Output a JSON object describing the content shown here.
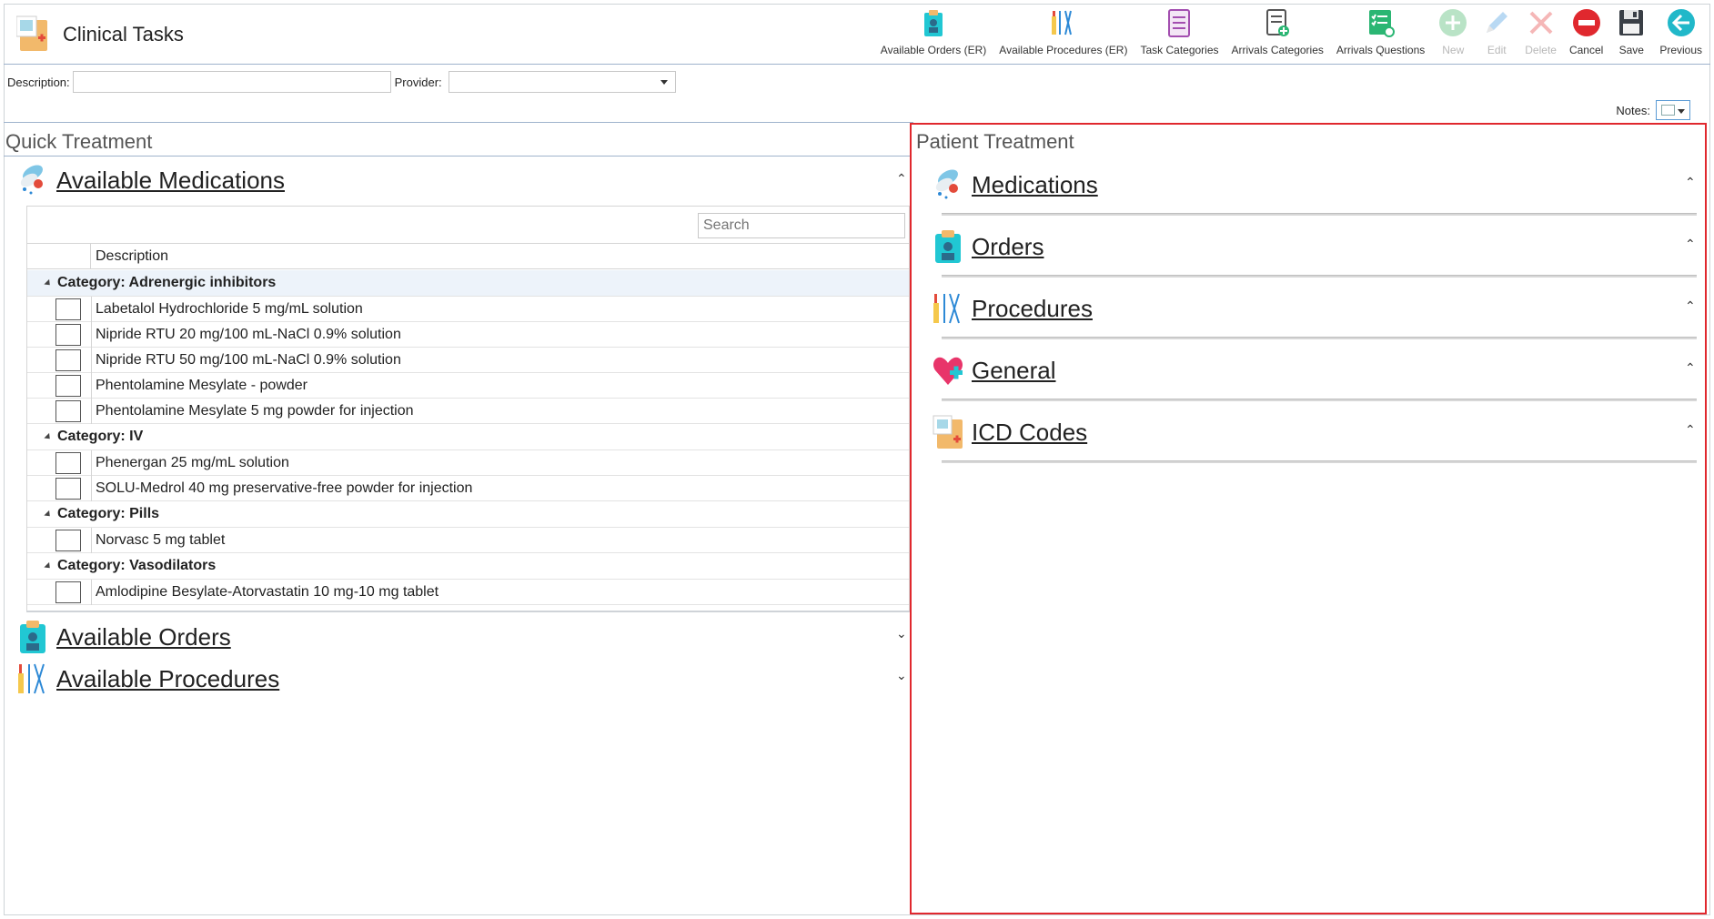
{
  "app": {
    "title": "Clinical Tasks",
    "logo_icon": "clinical-tasks-logo-icon"
  },
  "toolbar": [
    {
      "label": "Available Orders (ER)",
      "icon": "orders-icon",
      "enabled": true
    },
    {
      "label": "Available Procedures (ER)",
      "icon": "procedures-icon",
      "enabled": true
    },
    {
      "label": "Task Categories",
      "icon": "task-categories-icon",
      "enabled": true
    },
    {
      "label": "Arrivals Categories",
      "icon": "arrivals-categories-icon",
      "enabled": true
    },
    {
      "label": "Arrivals Questions",
      "icon": "arrivals-questions-icon",
      "enabled": true
    },
    {
      "label": "New",
      "icon": "plus-icon",
      "enabled": false
    },
    {
      "label": "Edit",
      "icon": "pencil-icon",
      "enabled": false
    },
    {
      "label": "Delete",
      "icon": "delete-x-icon",
      "enabled": false
    },
    {
      "label": "Cancel",
      "icon": "cancel-icon",
      "enabled": true
    },
    {
      "label": "Save",
      "icon": "save-icon",
      "enabled": true
    },
    {
      "label": "Previous",
      "icon": "back-arrow-icon",
      "enabled": true
    }
  ],
  "filters": {
    "description_label": "Description:",
    "description_value": "",
    "provider_label": "Provider:",
    "provider_value": ""
  },
  "notes": {
    "label": "Notes:"
  },
  "quick_treatment": {
    "title": "Quick Treatment",
    "sections": [
      {
        "title": "Available Medications",
        "expanded": true
      },
      {
        "title": "Available Orders",
        "expanded": false
      },
      {
        "title": "Available Procedures",
        "expanded": false
      }
    ],
    "search_placeholder": "Search",
    "column_header": "Description",
    "categories": [
      {
        "name": "Category: Adrenergic inhibitors",
        "items": [
          "Labetalol Hydrochloride 5 mg/mL solution",
          "Nipride RTU 20 mg/100 mL-NaCl 0.9% solution",
          "Nipride RTU 50 mg/100 mL-NaCl 0.9% solution",
          "Phentolamine Mesylate - powder",
          "Phentolamine Mesylate 5 mg powder for injection"
        ]
      },
      {
        "name": "Category: IV",
        "items": [
          "Phenergan 25 mg/mL solution",
          "SOLU-Medrol 40 mg preservative-free powder for injection"
        ]
      },
      {
        "name": "Category: Pills",
        "items": [
          "Norvasc 5 mg tablet"
        ]
      },
      {
        "name": "Category: Vasodilators",
        "items": [
          "Amlodipine Besylate-Atorvastatin 10 mg-10 mg tablet"
        ]
      }
    ]
  },
  "patient_treatment": {
    "title": "Patient Treatment",
    "sections": [
      {
        "title": "Medications",
        "icon": "medications-icon"
      },
      {
        "title": "Orders",
        "icon": "orders-icon"
      },
      {
        "title": "Procedures",
        "icon": "procedures-icon"
      },
      {
        "title": "General",
        "icon": "heart-plus-icon"
      },
      {
        "title": "ICD Codes",
        "icon": "icd-codes-icon"
      }
    ]
  },
  "colors": {
    "highlight_border": "#e0282e",
    "separator": "#9fb3cc",
    "category_row_selected": "#edf3fa"
  }
}
